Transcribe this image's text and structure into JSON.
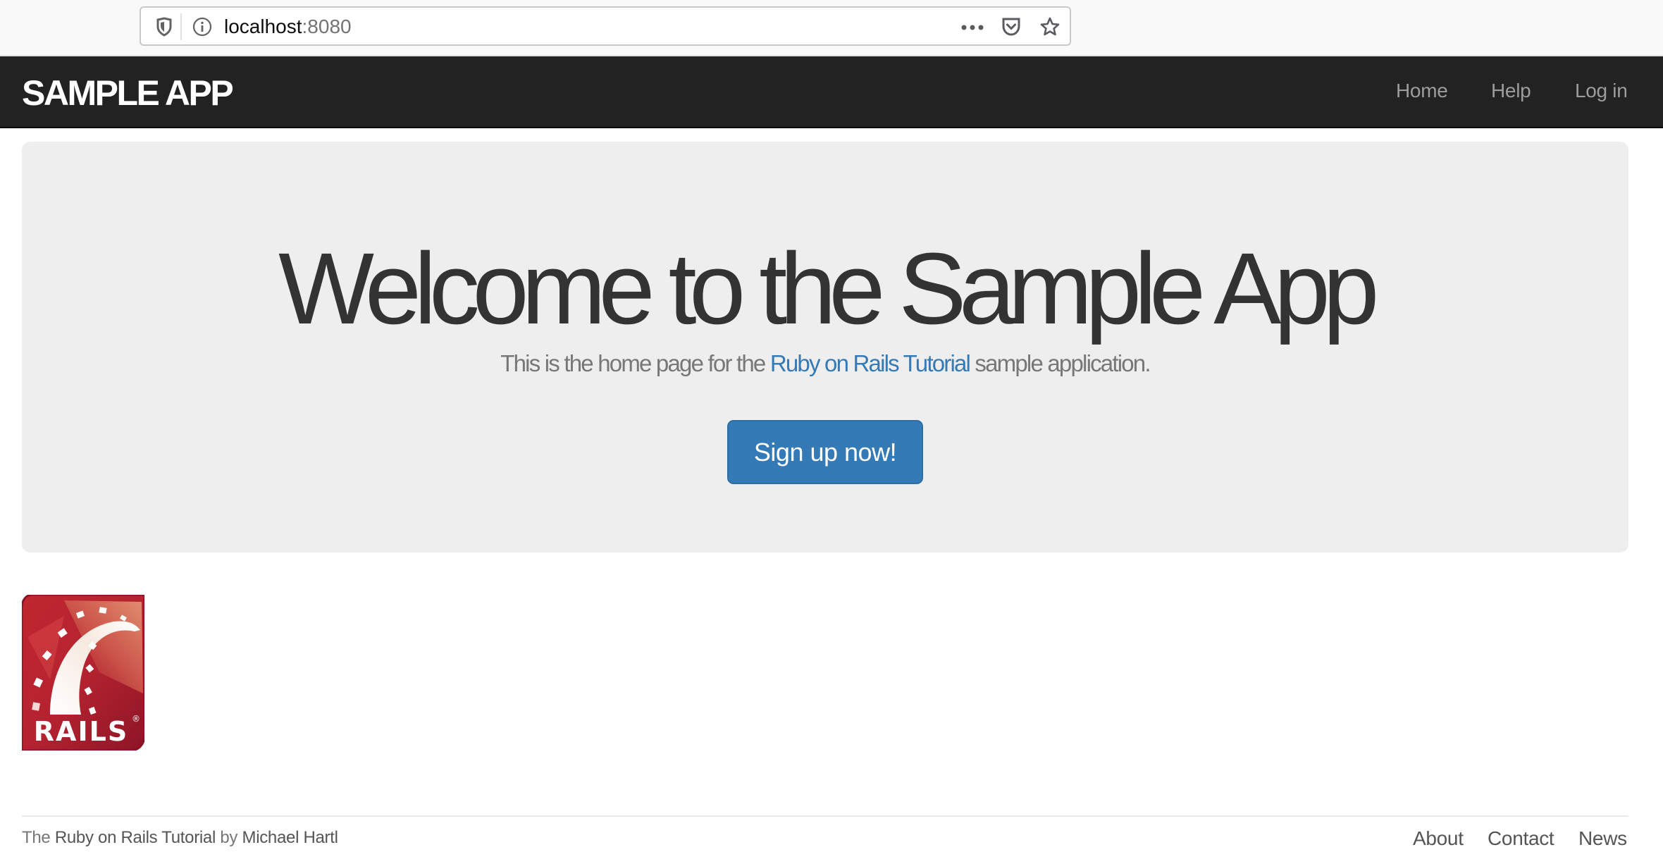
{
  "browser": {
    "url_host": "localhost",
    "url_port": ":8080",
    "icons": [
      "shield-icon",
      "info-icon",
      "more-icon",
      "pocket-icon",
      "star-icon"
    ]
  },
  "navbar": {
    "logo": "SAMPLE APP",
    "links": [
      {
        "label": "Home"
      },
      {
        "label": "Help"
      },
      {
        "label": "Log in"
      }
    ]
  },
  "jumbotron": {
    "title": "Welcome to the Sample App",
    "subtitle_prefix": "This is the home page for the ",
    "subtitle_link": "Ruby on Rails Tutorial",
    "subtitle_suffix": " sample application.",
    "signup_button": "Sign up now!"
  },
  "rails_logo": {
    "text": "RAILS",
    "trademark": "®"
  },
  "footer": {
    "prefix": "The ",
    "tutorial_link": "Ruby on Rails Tutorial",
    "by": " by ",
    "author_link": "Michael Hartl",
    "links": [
      {
        "label": "About"
      },
      {
        "label": "Contact"
      },
      {
        "label": "News"
      }
    ]
  },
  "colors": {
    "navbar_bg": "#222222",
    "nav_link": "#9d9d9d",
    "jumbotron_bg": "#eeeeee",
    "primary": "#337ab7",
    "heading": "#333333",
    "muted": "#777777"
  }
}
